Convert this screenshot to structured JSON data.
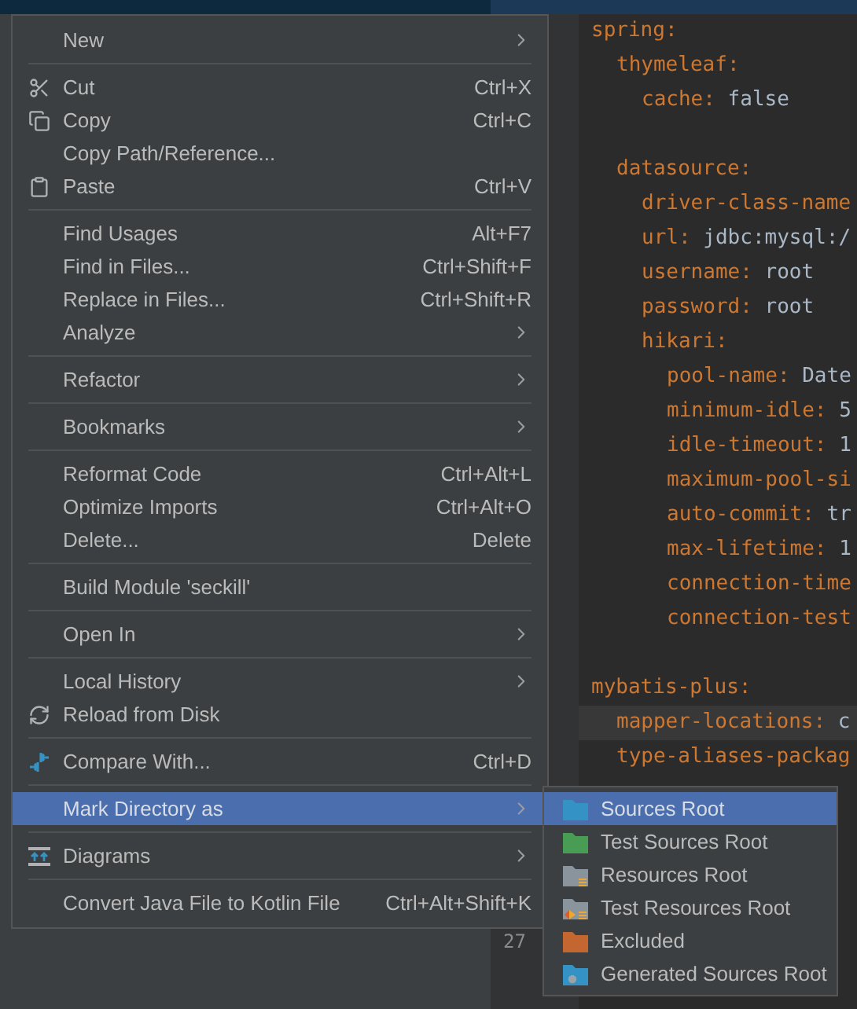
{
  "editor": {
    "lines": [
      {
        "kind": "entry",
        "key": "spring:",
        "current": false,
        "children": [
          {
            "kind": "entry",
            "key": "thymeleaf:",
            "current": false,
            "children": [
              {
                "kind": "entry",
                "key": "cache:",
                "value": "false",
                "current": false
              }
            ]
          },
          {
            "kind": "blank"
          },
          {
            "kind": "entry",
            "key": "datasource:",
            "current": false,
            "children": [
              {
                "kind": "entry",
                "key": "driver-class-name",
                "current": false
              },
              {
                "kind": "entry",
                "key": "url:",
                "value": "jdbc:mysql:/",
                "current": false
              },
              {
                "kind": "entry",
                "key": "username:",
                "value": "root",
                "current": false
              },
              {
                "kind": "entry",
                "key": "password:",
                "value": "root",
                "current": false
              },
              {
                "kind": "entry",
                "key": "hikari:",
                "current": false,
                "children": [
                  {
                    "kind": "entry",
                    "key": "pool-name:",
                    "value": "Date",
                    "current": false
                  },
                  {
                    "kind": "entry",
                    "key": "minimum-idle:",
                    "value": "5",
                    "current": false
                  },
                  {
                    "kind": "entry",
                    "key": "idle-timeout:",
                    "value": "1",
                    "current": false
                  },
                  {
                    "kind": "entry",
                    "key": "maximum-pool-si",
                    "current": false
                  },
                  {
                    "kind": "entry",
                    "key": "auto-commit:",
                    "value": "tr",
                    "current": false
                  },
                  {
                    "kind": "entry",
                    "key": "max-lifetime:",
                    "value": "1",
                    "current": false
                  },
                  {
                    "kind": "entry",
                    "key": "connection-time",
                    "current": false
                  },
                  {
                    "kind": "entry",
                    "key": "connection-test",
                    "current": false
                  }
                ]
              }
            ]
          }
        ]
      },
      {
        "kind": "blank"
      },
      {
        "kind": "entry",
        "key": "mybatis-plus:",
        "current": false,
        "children": [
          {
            "kind": "entry",
            "key": "mapper-locations:",
            "value": "c",
            "current": true
          },
          {
            "kind": "entry",
            "key": "type-aliases-packag",
            "current": false
          }
        ]
      }
    ],
    "line_number": "27"
  },
  "context_menu": {
    "items": [
      {
        "kind": "item",
        "label": "New",
        "submenu": true,
        "selected": false
      },
      {
        "kind": "separator"
      },
      {
        "kind": "item",
        "label": "Cut",
        "shortcut": "Ctrl+X",
        "submenu": false,
        "selected": false
      },
      {
        "kind": "item",
        "label": "Copy",
        "shortcut": "Ctrl+C",
        "submenu": false,
        "selected": false
      },
      {
        "kind": "item",
        "label": "Copy Path/Reference...",
        "submenu": false,
        "selected": false
      },
      {
        "kind": "item",
        "label": "Paste",
        "shortcut": "Ctrl+V",
        "submenu": false,
        "selected": false
      },
      {
        "kind": "separator"
      },
      {
        "kind": "item",
        "label": "Find Usages",
        "shortcut": "Alt+F7",
        "submenu": false,
        "selected": false
      },
      {
        "kind": "item",
        "label": "Find in Files...",
        "shortcut": "Ctrl+Shift+F",
        "submenu": false,
        "selected": false
      },
      {
        "kind": "item",
        "label": "Replace in Files...",
        "shortcut": "Ctrl+Shift+R",
        "submenu": false,
        "selected": false
      },
      {
        "kind": "item",
        "label": "Analyze",
        "submenu": true,
        "selected": false
      },
      {
        "kind": "separator"
      },
      {
        "kind": "item",
        "label": "Refactor",
        "submenu": true,
        "selected": false
      },
      {
        "kind": "separator"
      },
      {
        "kind": "item",
        "label": "Bookmarks",
        "submenu": true,
        "selected": false
      },
      {
        "kind": "separator"
      },
      {
        "kind": "item",
        "label": "Reformat Code",
        "shortcut": "Ctrl+Alt+L",
        "submenu": false,
        "selected": false
      },
      {
        "kind": "item",
        "label": "Optimize Imports",
        "shortcut": "Ctrl+Alt+O",
        "submenu": false,
        "selected": false
      },
      {
        "kind": "item",
        "label": "Delete...",
        "shortcut": "Delete",
        "submenu": false,
        "selected": false
      },
      {
        "kind": "separator"
      },
      {
        "kind": "item",
        "label": "Build Module 'seckill'",
        "submenu": false,
        "selected": false
      },
      {
        "kind": "separator"
      },
      {
        "kind": "item",
        "label": "Open In",
        "submenu": true,
        "selected": false
      },
      {
        "kind": "separator"
      },
      {
        "kind": "item",
        "label": "Local History",
        "submenu": true,
        "selected": false
      },
      {
        "kind": "item",
        "label": "Reload from Disk",
        "submenu": false,
        "selected": false
      },
      {
        "kind": "separator"
      },
      {
        "kind": "item",
        "label": "Compare With...",
        "shortcut": "Ctrl+D",
        "submenu": false,
        "selected": false
      },
      {
        "kind": "separator"
      },
      {
        "kind": "item",
        "label": "Mark Directory as",
        "submenu": true,
        "selected": true
      },
      {
        "kind": "separator"
      },
      {
        "kind": "item",
        "label": "Diagrams",
        "submenu": true,
        "selected": false
      },
      {
        "kind": "separator"
      },
      {
        "kind": "item",
        "label": "Convert Java File to Kotlin File",
        "shortcut": "Ctrl+Alt+Shift+K",
        "submenu": false,
        "selected": false
      }
    ]
  },
  "submenu": {
    "items": [
      {
        "label": "Sources Root",
        "color": "#3592c4",
        "selected": true
      },
      {
        "label": "Test Sources Root",
        "color": "#499c54",
        "selected": false
      },
      {
        "label": "Resources Root",
        "color": "#8a949c",
        "selected": false
      },
      {
        "label": "Test Resources Root",
        "color": "#8a949c",
        "selected": false
      },
      {
        "label": "Excluded",
        "color": "#c3662f",
        "selected": false
      },
      {
        "label": "Generated Sources Root",
        "color": "#3592c4",
        "selected": false
      }
    ]
  }
}
